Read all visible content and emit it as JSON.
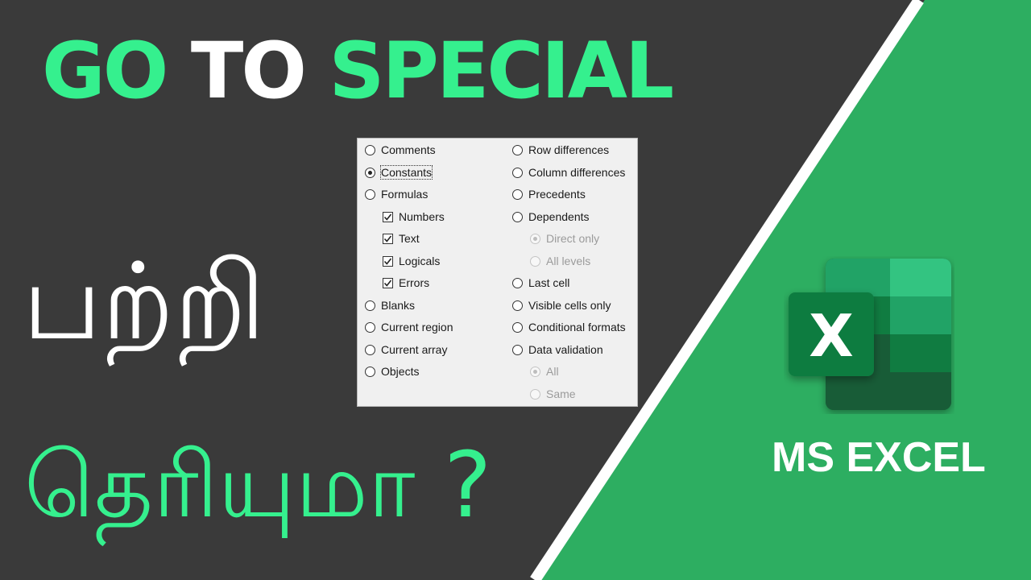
{
  "title": {
    "word1": "GO",
    "word2": "TO",
    "word3": "SPECIAL"
  },
  "subtitle_line1": "பற்றி",
  "subtitle_line2": "தெரியுமா ?",
  "brand_label": "MS EXCEL",
  "logo_letter": "X",
  "dialog": {
    "left_options": [
      {
        "label": "Comments",
        "type": "radio",
        "selected": false
      },
      {
        "label": "Constants",
        "type": "radio",
        "selected": true
      },
      {
        "label": "Formulas",
        "type": "radio",
        "selected": false
      }
    ],
    "formula_types": [
      {
        "label": "Numbers",
        "checked": true
      },
      {
        "label": "Text",
        "checked": true
      },
      {
        "label": "Logicals",
        "checked": true
      },
      {
        "label": "Errors",
        "checked": true
      }
    ],
    "left_more": [
      {
        "label": "Blanks",
        "selected": false
      },
      {
        "label": "Current region",
        "selected": false
      },
      {
        "label": "Current array",
        "selected": false
      },
      {
        "label": "Objects",
        "selected": false
      }
    ],
    "right_options": [
      {
        "label": "Row differences",
        "selected": false
      },
      {
        "label": "Column differences",
        "selected": false
      },
      {
        "label": "Precedents",
        "selected": false
      },
      {
        "label": "Dependents",
        "selected": false
      }
    ],
    "dependents_sub": [
      {
        "label": "Direct only",
        "selected": true,
        "disabled": true
      },
      {
        "label": "All levels",
        "selected": false,
        "disabled": true
      }
    ],
    "right_more": [
      {
        "label": "Last cell",
        "selected": false
      },
      {
        "label": "Visible cells only",
        "selected": false
      },
      {
        "label": "Conditional formats",
        "selected": false
      },
      {
        "label": "Data validation",
        "selected": false
      }
    ],
    "validation_sub": [
      {
        "label": "All",
        "selected": true,
        "disabled": true
      },
      {
        "label": "Same",
        "selected": false,
        "disabled": true
      }
    ]
  },
  "colors": {
    "dark_bg": "#3a3a3a",
    "accent_green": "#35f08e",
    "panel_green": "#2dae61",
    "divider_white": "#ffffff",
    "excel_dark": "#185c37",
    "excel_mid": "#21a366",
    "excel_light": "#33c481",
    "excel_base": "#107c41"
  }
}
